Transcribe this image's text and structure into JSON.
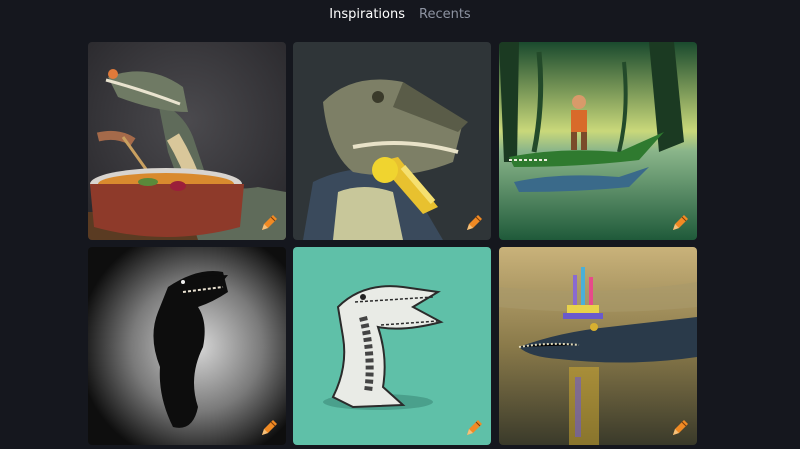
{
  "tabs": [
    {
      "label": "Inspirations",
      "active": true
    },
    {
      "label": "Recents",
      "active": false
    }
  ],
  "colors": {
    "background": "#15171e",
    "tab_active": "#ffffff",
    "tab_inactive": "#8d93a1",
    "edit_icon": "#f08a24"
  },
  "gallery": {
    "items": [
      {
        "id": "crocodile-soup",
        "icon": "pencil-icon"
      },
      {
        "id": "crocodile-eating",
        "icon": "pencil-icon"
      },
      {
        "id": "crocodile-swamp-rider",
        "icon": "pencil-icon"
      },
      {
        "id": "crocodile-silhouette",
        "icon": "pencil-icon"
      },
      {
        "id": "crocodile-sketch",
        "icon": "pencil-icon"
      },
      {
        "id": "crocodile-birthday",
        "icon": "pencil-icon"
      }
    ]
  }
}
